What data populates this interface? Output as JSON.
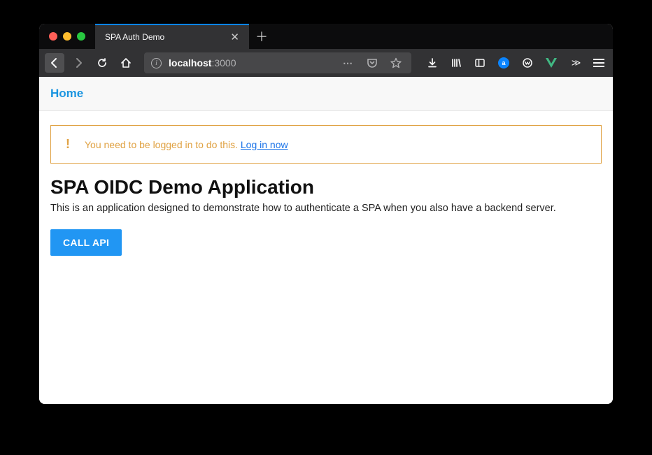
{
  "browser": {
    "tab_title": "SPA Auth Demo",
    "url_host": "localhost",
    "url_port": ":3000"
  },
  "nav": {
    "home_label": "Home"
  },
  "alert": {
    "icon_glyph": "!",
    "message": "You need to be logged in to do this. ",
    "link_label": "Log in now"
  },
  "page": {
    "title": "SPA OIDC Demo Application",
    "description": "This is an application designed to demonstrate how to authenticate a SPA when you also have a backend server."
  },
  "buttons": {
    "call_api": "CALL API"
  }
}
